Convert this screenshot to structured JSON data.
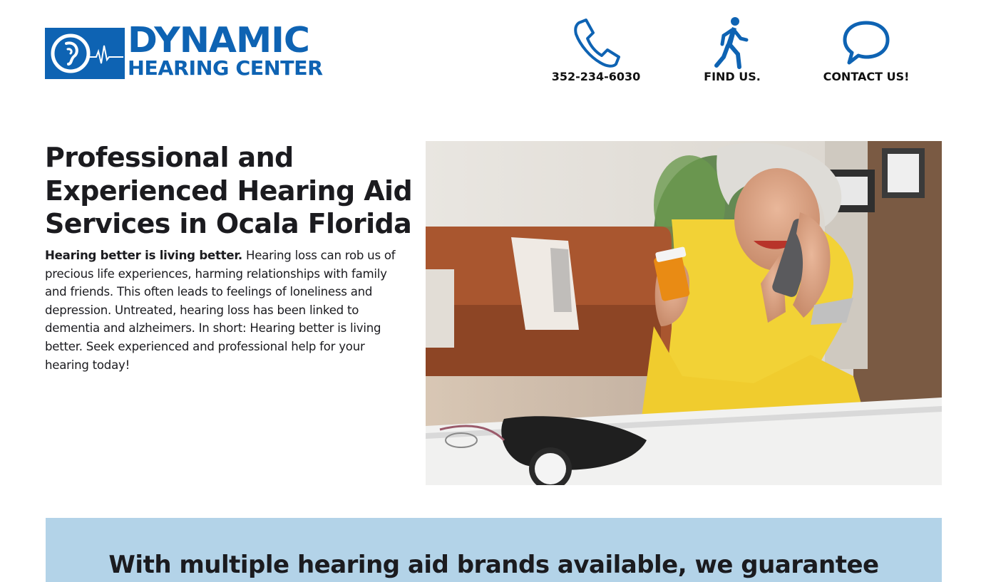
{
  "header": {
    "logo": {
      "line1": "DYNAMIC",
      "line2": "HEARING CENTER",
      "brand_color": "#0e63b3"
    },
    "links": [
      {
        "label": "352-234-6030",
        "icon": "phone-icon"
      },
      {
        "label": "FIND US.",
        "icon": "walking-person-icon"
      },
      {
        "label": "CONTACT US!",
        "icon": "speech-bubble-icon"
      }
    ]
  },
  "hero": {
    "title": "Professional and Experienced Hearing Aid Services in Ocala Florida",
    "lead_bold": "Hearing better is living better.",
    "body": "Hearing loss can rob us of precious life experiences, harming relationships with family and friends. This often leads to feelings of loneliness and depression. Untreated, hearing loss has been linked to dementia and alzheimers. In short: Hearing better is living better. Seek experienced and professional help for your hearing today!",
    "image": "photo-senior-woman-on-phone-holding-pill-bottle"
  },
  "banner": {
    "text": "With multiple hearing aid brands available, we guarantee",
    "background": "#b3d3e8"
  }
}
